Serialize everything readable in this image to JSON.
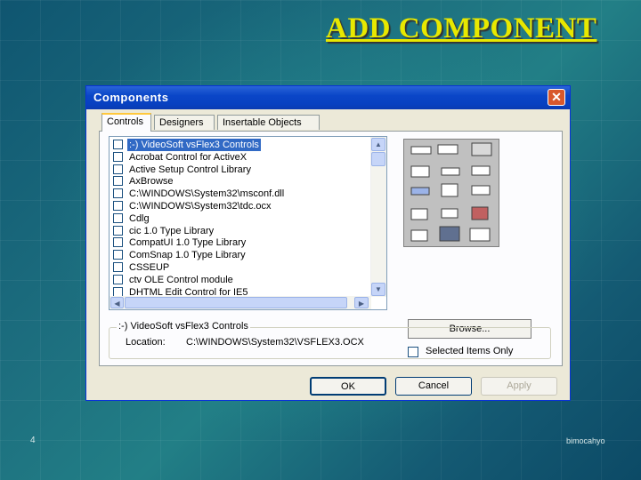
{
  "slide": {
    "title": "ADD COMPONENT",
    "page_number": "4",
    "author": "bimocahyo"
  },
  "dialog": {
    "title": "Components",
    "close_icon": "close-icon",
    "tabs": [
      {
        "label": "Controls",
        "active": true
      },
      {
        "label": "Designers",
        "active": false
      },
      {
        "label": "Insertable Objects",
        "active": false
      }
    ],
    "list": [
      {
        "label": ":-) VideoSoft vsFlex3 Controls",
        "selected": true
      },
      {
        "label": "Acrobat Control for ActiveX",
        "selected": false
      },
      {
        "label": "Active Setup Control Library",
        "selected": false
      },
      {
        "label": "AxBrowse",
        "selected": false
      },
      {
        "label": "C:\\WINDOWS\\System32\\msconf.dll",
        "selected": false
      },
      {
        "label": "C:\\WINDOWS\\System32\\tdc.ocx",
        "selected": false
      },
      {
        "label": "Cdlg",
        "selected": false
      },
      {
        "label": "cic 1.0 Type Library",
        "selected": false
      },
      {
        "label": "CompatUI 1.0 Type Library",
        "selected": false
      },
      {
        "label": "ComSnap 1.0 Type Library",
        "selected": false
      },
      {
        "label": "CSSEUP",
        "selected": false
      },
      {
        "label": "ctv OLE Control module",
        "selected": false
      },
      {
        "label": "DHTML Edit Control for IE5",
        "selected": false
      }
    ],
    "browse_label": "Browse...",
    "selected_only_label": "Selected Items Only",
    "group_title": ":-) VideoSoft vsFlex3 Controls",
    "location_label": "Location:",
    "location_value": "C:\\WINDOWS\\System32\\VSFLEX3.OCX",
    "buttons": {
      "ok": "OK",
      "cancel": "Cancel",
      "apply": "Apply"
    }
  },
  "colors": {
    "title_yellow": "#e8e800",
    "titlebar_blue": "#0a46c8",
    "selection_blue": "#316ac5",
    "dialog_face": "#ece9d8"
  }
}
